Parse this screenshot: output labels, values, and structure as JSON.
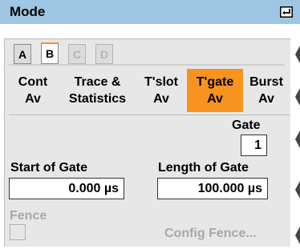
{
  "title": "Mode",
  "tabs": [
    {
      "label": "A",
      "state": "normal"
    },
    {
      "label": "B",
      "state": "active"
    },
    {
      "label": "C",
      "state": "disabled"
    },
    {
      "label": "D",
      "state": "disabled"
    }
  ],
  "modes": [
    {
      "line1": "Cont",
      "line2": "Av",
      "active": false
    },
    {
      "line1": "Trace &",
      "line2": "Statistics",
      "active": false
    },
    {
      "line1": "T'slot",
      "line2": "Av",
      "active": false
    },
    {
      "line1": "T'gate",
      "line2": "Av",
      "active": true
    },
    {
      "line1": "Burst",
      "line2": "Av",
      "active": false
    }
  ],
  "gate": {
    "label": "Gate",
    "value": "1"
  },
  "start_of_gate": {
    "label": "Start of Gate",
    "value": "0.000 µs"
  },
  "length_of_gate": {
    "label": "Length of Gate",
    "value": "100.000 µs"
  },
  "fence": {
    "label": "Fence",
    "checked": false
  },
  "config_fence": {
    "label": "Config Fence..."
  },
  "colors": {
    "title_bar": "#9ec6e3",
    "accent": "#f7931e",
    "panel": "#e7e7e7",
    "disabled": "#a8a8a8"
  },
  "icons": {
    "enter": "enter-key-icon",
    "side": "scroll-arrow-icon"
  }
}
